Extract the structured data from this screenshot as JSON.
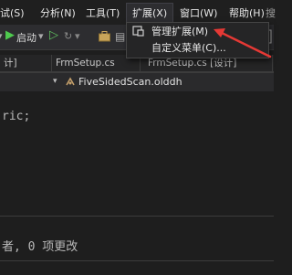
{
  "menubar": {
    "items": [
      "试(S)",
      "分析(N)",
      "工具(T)",
      "扩展(X)",
      "窗口(W)",
      "帮助(H)"
    ],
    "search_placeholder": "搜"
  },
  "toolbar": {
    "start_label": "启动",
    "start_dropdown": "▾"
  },
  "tabs": [
    {
      "label": "计]"
    },
    {
      "label": "FrmSetup.cs"
    },
    {
      "label": "FrmSetup.cs [设计]"
    }
  ],
  "navbar": {
    "file_label": "FiveSidedScan.olddh",
    "dropdown_glyph": "▾"
  },
  "editor": {
    "code_line": "ric;"
  },
  "lower_panel": {
    "status_text": "者, 0 项更改"
  },
  "extensions_menu": {
    "items": [
      {
        "label": "管理扩展(M)",
        "icon": "extension-manager-icon"
      },
      {
        "label": "自定义菜单(C)...",
        "icon": ""
      }
    ]
  },
  "annotation": {
    "color": "#e53935"
  }
}
